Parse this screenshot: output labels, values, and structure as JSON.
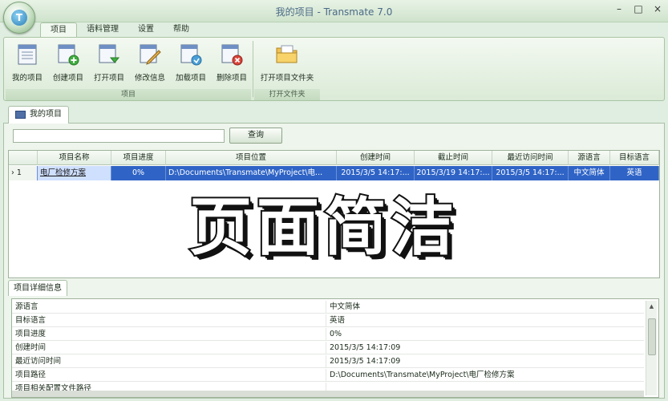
{
  "window": {
    "title": "我的项目 - Transmate 7.0",
    "logo_letter": "T",
    "controls": [
      "–",
      "□",
      "×"
    ]
  },
  "ribbon": {
    "tabs": [
      "项目",
      "语料管理",
      "设置",
      "帮助"
    ],
    "active_tab": "项目",
    "groups": [
      {
        "label": "项目",
        "buttons": [
          {
            "label": "我的项目",
            "icon": "project-list-icon"
          },
          {
            "label": "创建项目",
            "icon": "create-project-icon"
          },
          {
            "label": "打开项目",
            "icon": "open-project-icon"
          },
          {
            "label": "修改信息",
            "icon": "edit-info-icon"
          },
          {
            "label": "加载项目",
            "icon": "load-project-icon"
          },
          {
            "label": "删除项目",
            "icon": "delete-project-icon"
          }
        ]
      },
      {
        "label": "打开文件夹",
        "buttons": [
          {
            "label": "打开项目文件夹",
            "icon": "folder-icon"
          }
        ]
      }
    ]
  },
  "doc_tab": {
    "label": "我的项目"
  },
  "search": {
    "value": "",
    "button_label": "查询"
  },
  "grid": {
    "columns": [
      "项目名称",
      "项目进度",
      "项目位置",
      "创建时间",
      "截止时间",
      "最近访问时间",
      "源语言",
      "目标语言"
    ],
    "rows": [
      {
        "row_header": "› 1",
        "cells": [
          "电厂检修方案",
          "0%",
          "D:\\Documents\\Transmate\\MyProject\\电...",
          "2015/3/5 14:17:...",
          "2015/3/19 14:17:...",
          "2015/3/5 14:17:...",
          "中文简体",
          "英语"
        ]
      }
    ]
  },
  "overlay_caption": "页面简洁",
  "details": {
    "tab_label": "项目详细信息",
    "rows": [
      {
        "key": "源语言",
        "value": "中文简体"
      },
      {
        "key": "目标语言",
        "value": "英语"
      },
      {
        "key": "项目进度",
        "value": "0%"
      },
      {
        "key": "创建时间",
        "value": "2015/3/5 14:17:09"
      },
      {
        "key": "最近访问时间",
        "value": "2015/3/5 14:17:09"
      },
      {
        "key": "项目路径",
        "value": "D:\\Documents\\Transmate\\MyProject\\电厂检修方案"
      },
      {
        "key": "项目相关配置文件路径",
        "value": ""
      }
    ]
  },
  "colors": {
    "selection": "#2f64c6",
    "ribbon_bg": "#dbead7",
    "overlay_text": "#ffffff",
    "overlay_outline": "#111111"
  }
}
